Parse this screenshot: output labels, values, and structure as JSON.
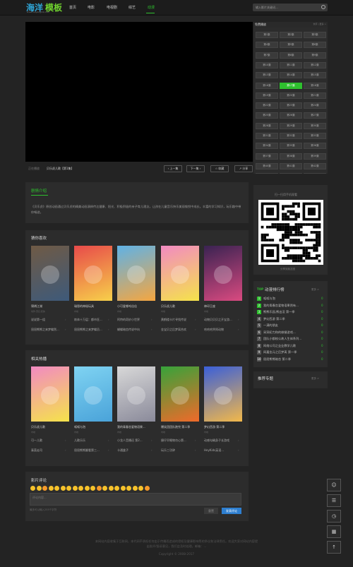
{
  "header": {
    "logo_part1": "海洋",
    "logo_part2": "模板",
    "logo_sub": "www.haiyangmb.com",
    "nav": [
      "首页",
      "电影",
      "电视剧",
      "综艺",
      "动漫"
    ],
    "active_nav": "动漫",
    "search_placeholder": "输入影片关键词..."
  },
  "playlist": {
    "title": "免费播放",
    "more": "倒序 | 更多 >",
    "episodes": [
      "第1集",
      "第2集",
      "第3集",
      "第4集",
      "第5集",
      "第6集",
      "第7集",
      "第8集",
      "第9集",
      "第10集",
      "第11集",
      "第12集",
      "第13集",
      "第14集",
      "第15集",
      "第16集",
      "第17集",
      "第18集",
      "第19集",
      "第20集",
      "第21集",
      "第22集",
      "第23集",
      "第24集",
      "第25集",
      "第26集",
      "第27集",
      "第28集",
      "第29集",
      "第30集",
      "第31集",
      "第32集",
      "第33集",
      "第34集",
      "第35集",
      "第36集",
      "第37集",
      "第38集",
      "第39集",
      "第40集",
      "第41集",
      "第42集",
      "第43集",
      "第44集",
      "第45集"
    ],
    "active_episode": "第17集"
  },
  "player_bar": {
    "now_label": "正在播放",
    "now_title": "贝乐虎儿歌【第1集】",
    "prev": "上一集",
    "next": "下一集",
    "fav": "收藏",
    "share": "分享"
  },
  "intro": {
    "title": "剧情介绍",
    "text": "《贝乐虎》原创动画通过贝乐虎的精美动画演绎传达健康、阳光、积极积极的亲子育儿理念，让孩在儿童音乐快乐美丽愉悦中成长。丰富的学习知识，玩乐趣中带你畅游。"
  },
  "guess": {
    "title": "猜你喜欢",
    "items": [
      {
        "name": "锦绣江湖",
        "sub": "动作,奇幻,武侠",
        "colors": [
          "#6f5a45",
          "#3e5a7a"
        ]
      },
      {
        "name": "瑞恩的神秘玩具",
        "sub": "内地",
        "colors": [
          "#e84a4a",
          "#f7d04a"
        ]
      },
      {
        "name": "小可爱哪吒佳佳",
        "sub": "内地",
        "colors": [
          "#5fb2e6",
          "#f5a640"
        ]
      },
      {
        "name": "贝乐虎儿歌",
        "sub": "内地",
        "colors": [
          "#f28ac2",
          "#f5e34a"
        ]
      },
      {
        "name": "神印王座",
        "sub": "内地",
        "colors": [
          "#3a2352",
          "#d94a80"
        ]
      }
    ],
    "rows": [
      [
        "说说第一组",
        "炼体十万层：都市狂...",
        "阿特的奇妙小世界",
        "黄鹤楼卡片寻找传说",
        "动物贝贝贝之开宝游..."
      ],
      [
        "屈屈熊熊之来梦蝶然...",
        "屈屈熊熊之来梦蝶员...",
        "蝴蝶暗恋传说中向",
        "金宝贝之后梦离合欢",
        "哈哈哈哭闹动物"
      ]
    ]
  },
  "hot": {
    "title": "相关热播",
    "items": [
      {
        "name": "贝乐虎儿歌",
        "sub": "内地",
        "colors": [
          "#f28ac2",
          "#f5e34a"
        ]
      },
      {
        "name": "呱呱与泡",
        "sub": "内地",
        "colors": [
          "#7fd3f2",
          "#4aa3d9"
        ]
      },
      {
        "name": "我的青春恋爱物语果...",
        "sub": "内地",
        "colors": [
          "#d8d8d8",
          "#8a8a9a"
        ]
      },
      {
        "name": "爆笑团团队跑完 第二季",
        "sub": "内地",
        "colors": [
          "#36a33a",
          "#f06a2a"
        ]
      },
      {
        "name": "梦幻西游 第二季",
        "sub": "内地",
        "colors": [
          "#3a5fd9",
          "#f2b84a"
        ]
      }
    ],
    "rows": [
      [
        "可一儿歌",
        "儿歌乐乐",
        "小龙人音播还 第2...",
        "捷仔早睡物勿心第...",
        "动感勾确身子长游戏"
      ],
      [
        "泰菜走司",
        "屈屈熊熊翻看第三...",
        "卡通盒子",
        "玩乐三功钟",
        "HeyKids英语..."
      ]
    ]
  },
  "qr": {
    "title": "扫一扫用手机观看",
    "caption": "分享到朋友圈"
  },
  "ranking": {
    "title": "动漫排行榜",
    "badge": "TOP",
    "more": "更多 >",
    "items": [
      {
        "n": "1",
        "name": "呱呱与泡",
        "v": "0"
      },
      {
        "n": "2",
        "name": "我的青春恋爱物语果然有...",
        "v": "0"
      },
      {
        "n": "3",
        "name": "熊熊乐园,熊出没 第一季",
        "v": "0"
      },
      {
        "n": "4",
        "name": "梦幻西游 第二季",
        "v": "0"
      },
      {
        "n": "5",
        "name": "一满的朋友",
        "v": "0"
      },
      {
        "n": "6",
        "name": "采洞初力和的做餐游戏...",
        "v": "0"
      },
      {
        "n": "7",
        "name": "团队小都校公故人生体系列...",
        "v": "0"
      },
      {
        "n": "8",
        "name": "网络公司之业业教学儿歌",
        "v": "0"
      },
      {
        "n": "9",
        "name": "网嘉金元之后梦离 第一季",
        "v": "0"
      },
      {
        "n": "10",
        "name": "屈屈熊熊暗恋 第二季",
        "v": "0"
      }
    ]
  },
  "topics": {
    "title": "推荐专题",
    "more": "更多 >"
  },
  "comments": {
    "title": "影片评论",
    "placeholder": "评论内容...",
    "count_hint": "最多可以输入255个字符",
    "reset": "重置",
    "submit": "发表评论"
  },
  "footer": {
    "line1": "本网站内容收集于互联网，本代网不承担任何由于传播而造成的侵权及健康影响等的争议和法律责任。欢迎大家对网站内容提",
    "line2": "出批评/投诉意见，我们会及时处理。邮箱：...",
    "copyright": "Copyright © 2008-2017"
  },
  "colors": {
    "accent": "#2ec02e",
    "background": "#232323",
    "panel": "#2c2c2c"
  }
}
